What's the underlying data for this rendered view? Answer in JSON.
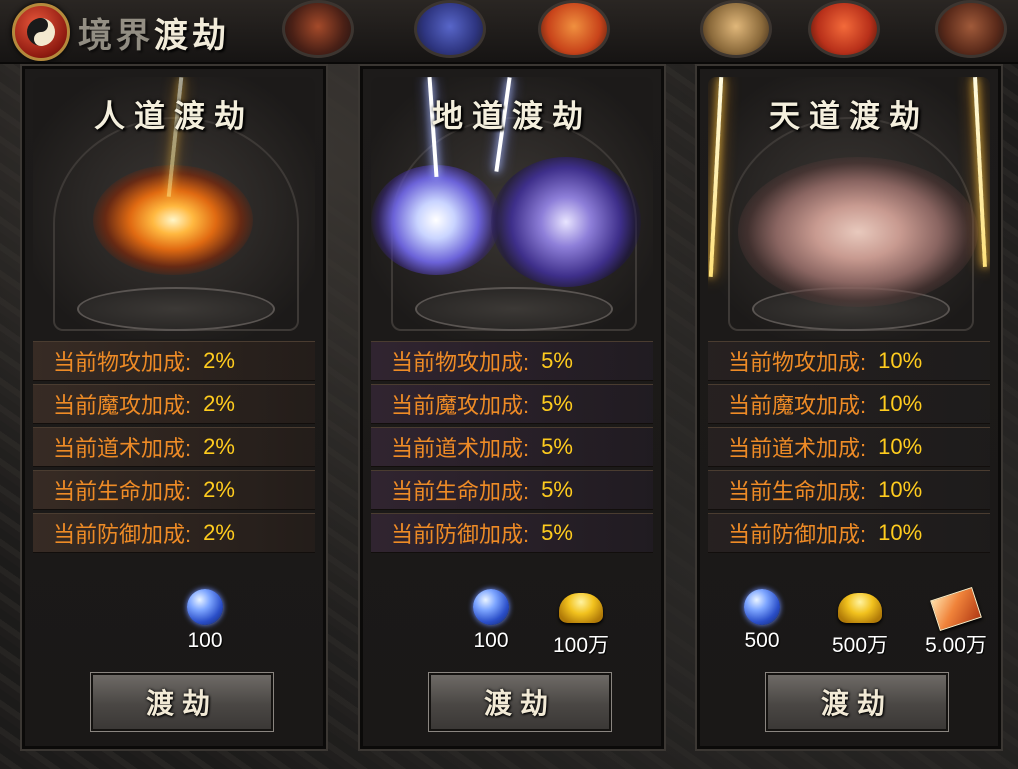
{
  "header": {
    "title_dim": "境界",
    "title": "渡劫"
  },
  "icons": {
    "top_left": "yin-yang-icon",
    "top_items": [
      "dark-item-icon",
      "blue-bag-icon",
      "red-bag-icon",
      "statue-icon",
      "token-icon",
      "dark-item-icon-2"
    ]
  },
  "colors": {
    "stat_label": "#ee8b26",
    "stat_value": "#ffcc1e",
    "accent_gold": "#ffcc1e"
  },
  "panels": [
    {
      "title": "人道渡劫",
      "stats": [
        {
          "label": "当前物攻加成:",
          "value": "2%"
        },
        {
          "label": "当前魔攻加成:",
          "value": "2%"
        },
        {
          "label": "当前道术加成:",
          "value": "2%"
        },
        {
          "label": "当前生命加成:",
          "value": "2%"
        },
        {
          "label": "当前防御加成:",
          "value": "2%"
        }
      ],
      "costs": [
        {
          "icon": "crystal-icon",
          "amount": "100"
        }
      ],
      "button": "渡劫"
    },
    {
      "title": "地道渡劫",
      "stats": [
        {
          "label": "当前物攻加成:",
          "value": "5%"
        },
        {
          "label": "当前魔攻加成:",
          "value": "5%"
        },
        {
          "label": "当前道术加成:",
          "value": "5%"
        },
        {
          "label": "当前生命加成:",
          "value": "5%"
        },
        {
          "label": "当前防御加成:",
          "value": "5%"
        }
      ],
      "costs": [
        {
          "icon": "crystal-icon",
          "amount": "100"
        },
        {
          "icon": "gold-ingot-icon",
          "amount": "100万"
        }
      ],
      "button": "渡劫"
    },
    {
      "title": "天道渡劫",
      "stats": [
        {
          "label": "当前物攻加成:",
          "value": "10%"
        },
        {
          "label": "当前魔攻加成:",
          "value": "10%"
        },
        {
          "label": "当前道术加成:",
          "value": "10%"
        },
        {
          "label": "当前生命加成:",
          "value": "10%"
        },
        {
          "label": "当前防御加成:",
          "value": "10%"
        }
      ],
      "costs": [
        {
          "icon": "crystal-icon",
          "amount": "500"
        },
        {
          "icon": "gold-ingot-icon",
          "amount": "500万"
        },
        {
          "icon": "red-ticket-icon",
          "amount": "5.00万"
        }
      ],
      "button": "渡劫"
    }
  ]
}
